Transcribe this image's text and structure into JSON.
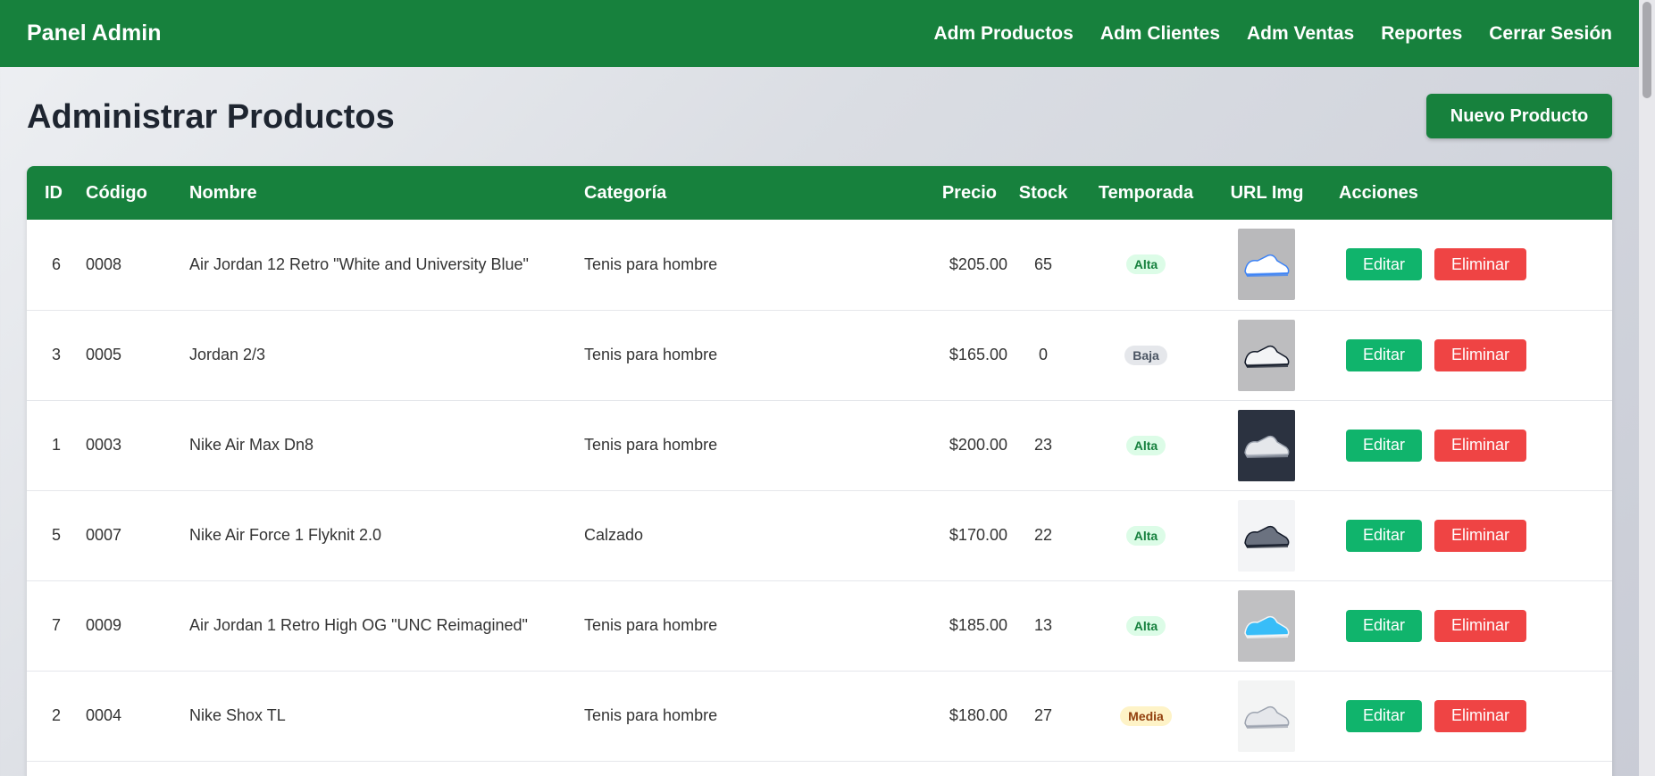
{
  "brand": "Panel Admin",
  "nav": [
    "Adm Productos",
    "Adm Clientes",
    "Adm Ventas",
    "Reportes",
    "Cerrar Sesión"
  ],
  "page_title": "Administrar Productos",
  "new_button": "Nuevo Producto",
  "columns": [
    "ID",
    "Código",
    "Nombre",
    "Categoría",
    "Precio",
    "Stock",
    "Temporada",
    "URL Img",
    "Acciones"
  ],
  "actions": {
    "edit": "Editar",
    "delete": "Eliminar"
  },
  "colors": {
    "primary": "#17813d",
    "edit": "#10b46c",
    "delete": "#ef4444"
  },
  "rows": [
    {
      "id": "6",
      "code": "0008",
      "name": "Air Jordan 12 Retro \"White and University Blue\"",
      "category": "Tenis para hombre",
      "price": "$205.00",
      "stock": "65",
      "season": "Alta",
      "image": "white-blue-sneaker"
    },
    {
      "id": "3",
      "code": "0005",
      "name": "Jordan 2/3",
      "category": "Tenis para hombre",
      "price": "$165.00",
      "stock": "0",
      "season": "Baja",
      "image": "white-black-sneaker"
    },
    {
      "id": "1",
      "code": "0003",
      "name": "Nike Air Max Dn8",
      "category": "Tenis para hombre",
      "price": "$200.00",
      "stock": "23",
      "season": "Alta",
      "image": "white-sneaker-dark-bg"
    },
    {
      "id": "5",
      "code": "0007",
      "name": "Nike Air Force 1 Flyknit 2.0",
      "category": "Calzado",
      "price": "$170.00",
      "stock": "22",
      "season": "Alta",
      "image": "grey-black-sneaker"
    },
    {
      "id": "7",
      "code": "0009",
      "name": "Air Jordan 1 Retro High OG \"UNC Reimagined\"",
      "category": "Tenis para hombre",
      "price": "$185.00",
      "stock": "13",
      "season": "Alta",
      "image": "blue-high-top-sneaker"
    },
    {
      "id": "2",
      "code": "0004",
      "name": "Nike Shox TL",
      "category": "Tenis para hombre",
      "price": "$180.00",
      "stock": "27",
      "season": "Media",
      "image": "white-silver-sneaker"
    }
  ]
}
